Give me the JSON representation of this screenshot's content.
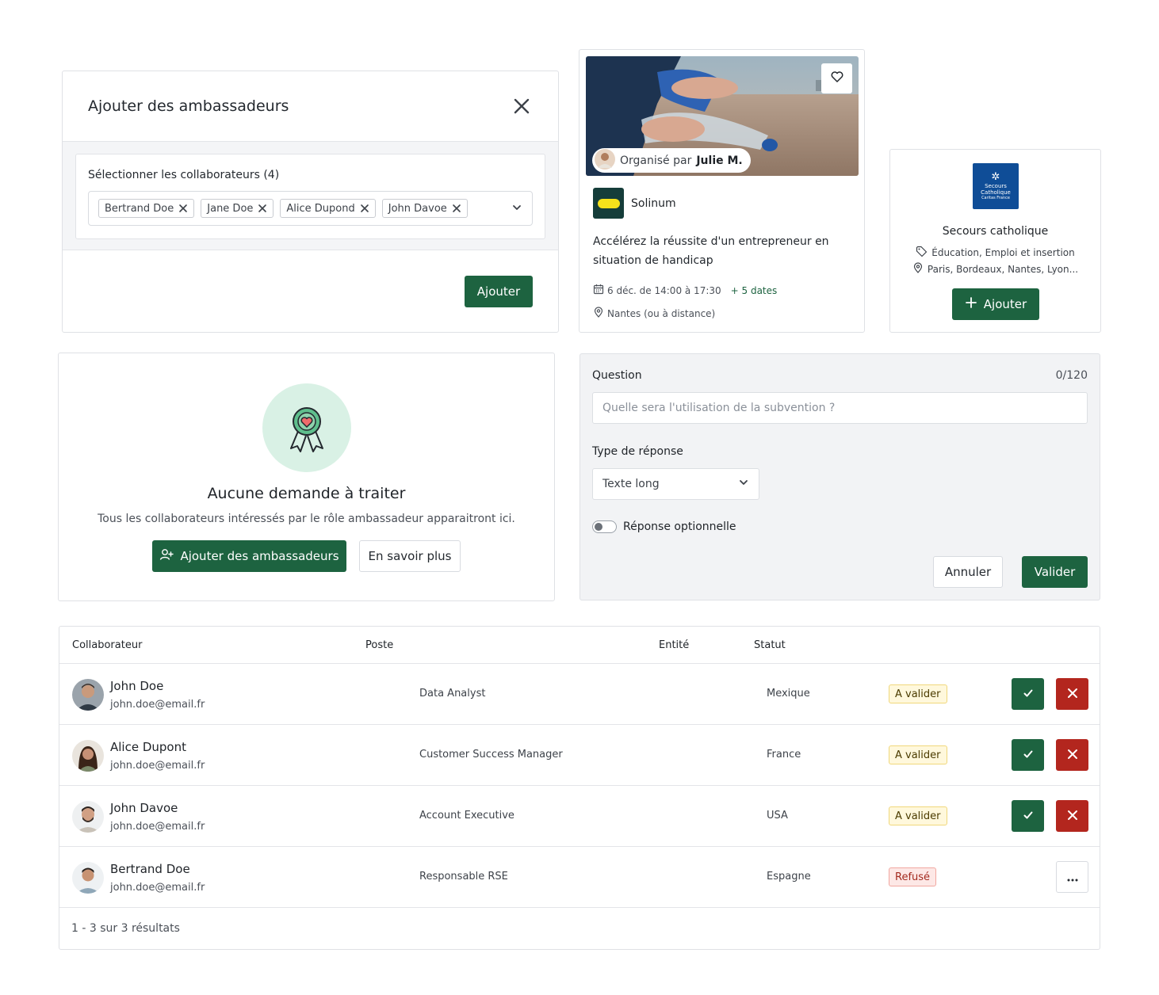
{
  "modal": {
    "title": "Ajouter des ambassadeurs",
    "select_label": "Sélectionner les collaborateurs (4)",
    "chips": [
      "Bertrand Doe",
      "Jane Doe",
      "Alice Dupond",
      "John Davoe"
    ],
    "submit_label": "Ajouter"
  },
  "event": {
    "organized_by_prefix": "Organisé par",
    "organizer_name": "Julie M.",
    "org_name": "Solinum",
    "title": "Accélérez la réussite d'un entrepreneur en situation de handicap",
    "date": "6 déc. de 14:00 à 17:30",
    "more_dates": "+ 5 dates",
    "location": "Nantes (ou à distance)"
  },
  "organization": {
    "logo_text": [
      "Secours",
      "Catholique",
      "Caritas France"
    ],
    "name": "Secours catholique",
    "tags": "Éducation, Emploi et insertion",
    "cities": "Paris, Bordeaux, Nantes, Lyon...",
    "add_label": "Ajouter",
    "brand_color": "#0f4d97"
  },
  "empty_state": {
    "title": "Aucune demande à traiter",
    "subtitle": "Tous les collaborateurs intéressés par le rôle ambassadeur apparaitront ici.",
    "primary_label": "Ajouter des ambassadeurs",
    "secondary_label": "En savoir plus"
  },
  "question_form": {
    "label": "Question",
    "counter": "0/120",
    "placeholder": "Quelle sera l'utilisation de la subvention ?",
    "type_label": "Type de réponse",
    "type_value": "Texte long",
    "optional_label": "Réponse optionnelle",
    "cancel_label": "Annuler",
    "confirm_label": "Valider"
  },
  "table": {
    "headers": [
      "Collaborateur",
      "Poste",
      "Entité",
      "Statut"
    ],
    "rows": [
      {
        "name": "John Doe",
        "email": "john.doe@email.fr",
        "poste": "Data Analyst",
        "entite": "Mexique",
        "status": "A valider"
      },
      {
        "name": "Alice Dupont",
        "email": "john.doe@email.fr",
        "poste": "Customer Success Manager",
        "entite": "France",
        "status": "A valider"
      },
      {
        "name": "John Davoe",
        "email": "john.doe@email.fr",
        "poste": "Account Executive",
        "entite": "USA",
        "status": "A valider"
      },
      {
        "name": "Bertrand Doe",
        "email": "john.doe@email.fr",
        "poste": "Responsable RSE",
        "entite": "Espagne",
        "status": "Refusé"
      }
    ],
    "footer": "1 - 3 sur 3 résultats"
  },
  "colors": {
    "primary_green": "#1d6340",
    "danger_red": "#b3261e",
    "mint": "#d9f1e5"
  }
}
